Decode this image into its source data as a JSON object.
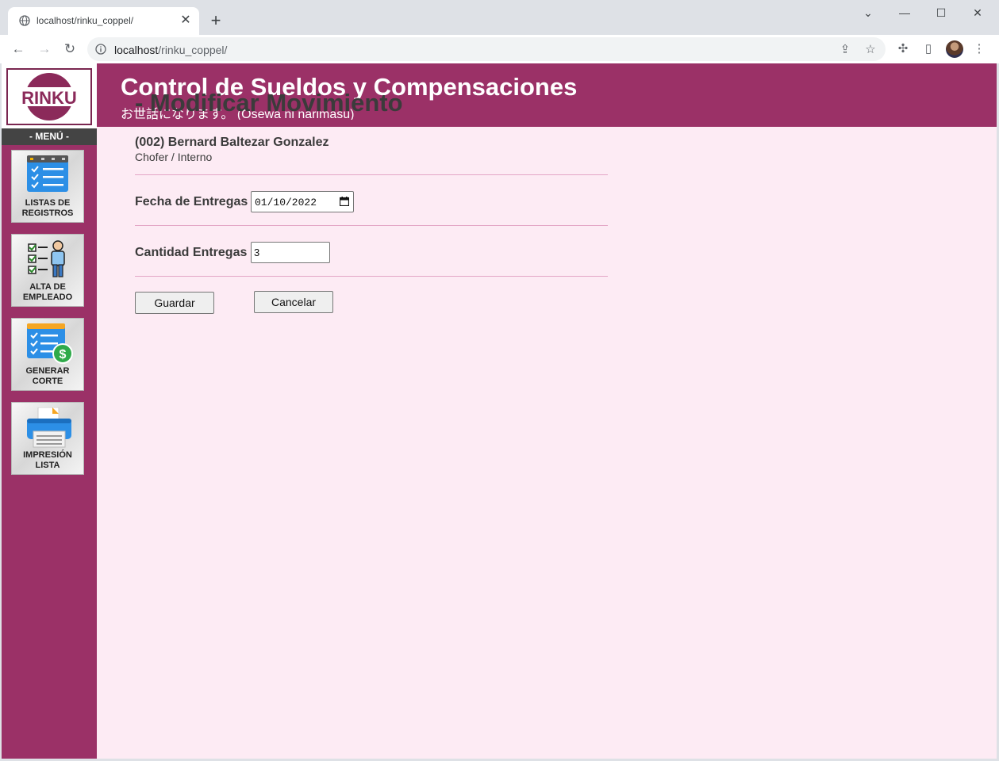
{
  "browser": {
    "tab_title": "localhost/rinku_coppel/",
    "tab_close": "✕",
    "new_tab": "+",
    "url_host": "localhost",
    "url_path": "/rinku_coppel/",
    "window": {
      "minimize": "—",
      "maximize": "☐",
      "close": "✕",
      "tabsearch": "⌄"
    },
    "nav": {
      "back": "←",
      "forward": "→",
      "reload": "↻"
    }
  },
  "sidebar": {
    "logo_text": "RINKU",
    "menu_label": "- MENÚ -",
    "items": [
      {
        "label_line1": "LISTAS DE",
        "label_line2": "REGISTROS",
        "icon": "checklist-icon"
      },
      {
        "label_line1": "ALTA DE",
        "label_line2": "EMPLEADO",
        "icon": "employee-checklist-icon"
      },
      {
        "label_line1": "GENERAR",
        "label_line2": "CORTE",
        "icon": "money-list-icon"
      },
      {
        "label_line1": "IMPRESIÓN",
        "label_line2": "LISTA",
        "icon": "printer-icon"
      }
    ]
  },
  "header": {
    "title": "Control de Sueldos y Compensaciones",
    "subtitle": "お世話になります。 (Osewa ni narimasu)"
  },
  "form": {
    "page_title": "- Modificar Movimiento",
    "employee_name": "(002) Bernard Baltezar Gonzalez",
    "employee_role": "Chofer / Interno",
    "date_label": "Fecha de Entregas",
    "date_value": "01/10/2022",
    "qty_label": "Cantidad Entregas",
    "qty_value": "3",
    "save_label": "Guardar",
    "cancel_label": "Cancelar"
  },
  "colors": {
    "brand": "#9b3167",
    "page_bg": "#fdebf4",
    "divider": "#e3a6c6"
  }
}
